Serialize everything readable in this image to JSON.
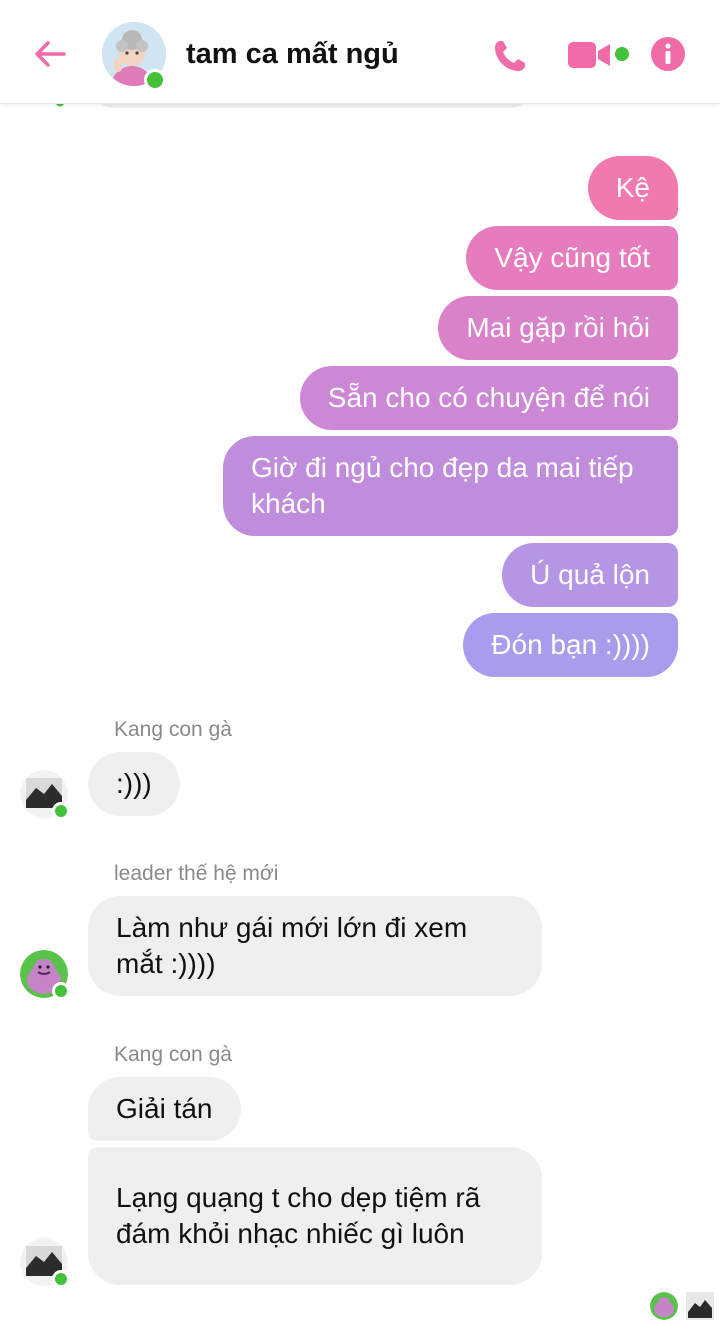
{
  "header": {
    "title": "tam ca mất ngủ",
    "accent": "#f06ba8",
    "online_color": "#44c03a"
  },
  "outgoing": [
    {
      "text": "Kệ",
      "color": "#f07ab0"
    },
    {
      "text": "Vậy cũng tốt",
      "color": "#e67cbd"
    },
    {
      "text": "Mai gặp rồi hỏi",
      "color": "#d982c9"
    },
    {
      "text": "Sẵn cho có chuyện để nói",
      "color": "#cd88d5"
    },
    {
      "text": "Giờ đi ngủ cho đẹp da mai tiếp khách",
      "color": "#c08ddd"
    },
    {
      "text": "Ú quả lộn",
      "color": "#b595e5"
    },
    {
      "text": "Đón bạn :))))",
      "color": "#a99cec"
    }
  ],
  "incoming": [
    {
      "sender": "Kang con gà",
      "text": ":)))"
    },
    {
      "sender": "leader thế hệ mới",
      "text": "Làm như gái mới lớn đi xem mắt :))))"
    },
    {
      "sender": "Kang con gà",
      "texts": [
        "Giải tán",
        "Lạng quạng t cho dẹp tiệm rã đám khỏi nhạc nhiếc gì luôn"
      ]
    }
  ],
  "icons": {
    "back": "arrow-left-icon",
    "call": "phone-icon",
    "video": "video-camera-icon",
    "info": "info-icon"
  }
}
